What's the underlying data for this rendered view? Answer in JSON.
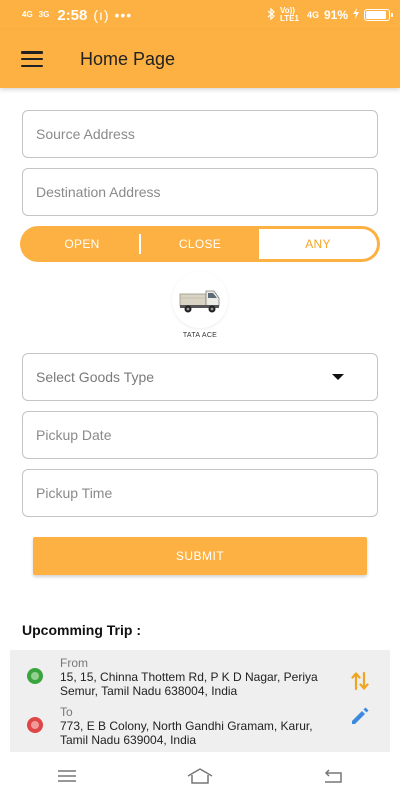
{
  "status_bar": {
    "signal_1": "4G",
    "signal_2": "3G",
    "time": "2:58",
    "extra": "(ı) •••",
    "volte": "Vo)) LTE1",
    "network": "4G",
    "battery": "91%",
    "battery_level": 0.91
  },
  "header": {
    "title": "Home Page",
    "menu_icon": "hamburger-menu-icon"
  },
  "form": {
    "source_placeholder": "Source Address",
    "destination_placeholder": "Destination Address",
    "body_type_options": [
      "OPEN",
      "CLOSE",
      "ANY"
    ],
    "body_type_selected": "ANY",
    "vehicle_label": "TATA ACE",
    "goods_type_placeholder": "Select Goods Type",
    "pickup_date_placeholder": "Pickup Date",
    "pickup_time_placeholder": "Pickup Time",
    "submit_label": "SUBMIT"
  },
  "upcoming": {
    "title": "Upcomming Trip :",
    "from_label": "From",
    "from_address": "15, 15, Chinna Thottem Rd, P K D Nagar, Periya Semur, Tamil Nadu 638004, India",
    "to_label": "To",
    "to_address": "773, E B Colony, North Gandhi Gramam, Karur, Tamil Nadu 639004, India"
  },
  "colors": {
    "accent": "#fdb142",
    "from_dot": "#3aa53f",
    "to_dot": "#e04646",
    "swap_icon": "#f0a623",
    "edit_icon": "#3b8ae0"
  }
}
